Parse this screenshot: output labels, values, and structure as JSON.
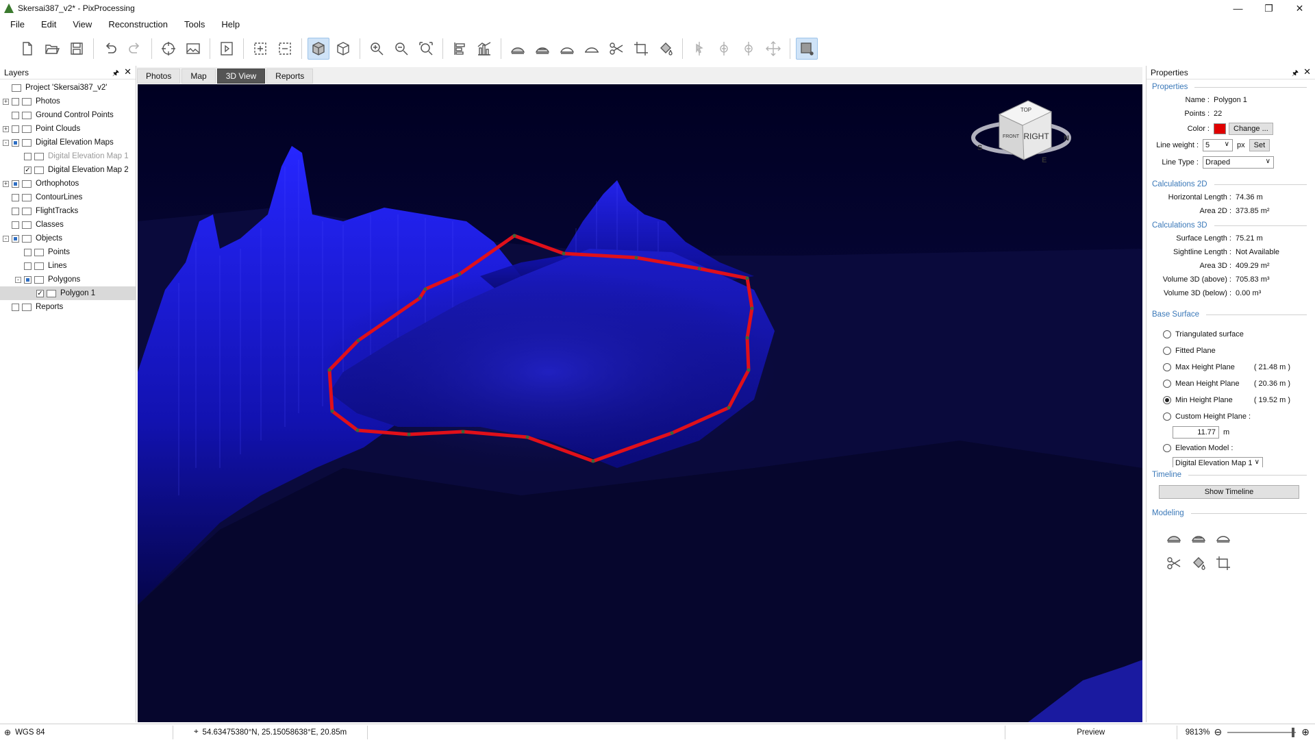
{
  "window": {
    "title": "Skersai387_v2* - PixProcessing",
    "controls": [
      "—",
      "❐",
      "✕"
    ]
  },
  "menu": [
    "File",
    "Edit",
    "View",
    "Reconstruction",
    "Tools",
    "Help"
  ],
  "toolbar_icons": [
    "new-file-icon",
    "open-folder-icon",
    "save-icon",
    "undo-icon",
    "redo-icon",
    "target-icon",
    "image-icon",
    "play-icon",
    "select-area-icon",
    "deselect-area-icon",
    "view-3d-solid-icon",
    "view-3d-wire-icon",
    "zoom-in-icon",
    "zoom-out-icon",
    "zoom-fit-icon",
    "align-icon",
    "chart-icon",
    "terrain-1-icon",
    "terrain-2-icon",
    "terrain-3-icon",
    "terrain-4-icon",
    "scissors-icon",
    "crop-icon",
    "fill-icon",
    "pointer-icon",
    "add-point-icon",
    "remove-point-icon",
    "move-point-icon",
    "draw-polygon-icon"
  ],
  "layers": {
    "title": "Layers",
    "items": [
      {
        "label": "Project 'Skersai387_v2'",
        "depth": 0,
        "expander": "none",
        "checkbox": "none"
      },
      {
        "label": "Photos",
        "depth": 0,
        "expander": "+",
        "checkbox": "empty"
      },
      {
        "label": "Ground Control Points",
        "depth": 0,
        "expander": "none",
        "checkbox": "empty"
      },
      {
        "label": "Point Clouds",
        "depth": 0,
        "expander": "+",
        "checkbox": "empty"
      },
      {
        "label": "Digital Elevation Maps",
        "depth": 0,
        "expander": "-",
        "checkbox": "partial"
      },
      {
        "label": "Digital Elevation Map 1",
        "depth": 1,
        "expander": "none",
        "checkbox": "empty",
        "dim": true
      },
      {
        "label": "Digital Elevation Map 2",
        "depth": 1,
        "expander": "none",
        "checkbox": "checked"
      },
      {
        "label": "Orthophotos",
        "depth": 0,
        "expander": "+",
        "checkbox": "partial"
      },
      {
        "label": "ContourLines",
        "depth": 0,
        "expander": "none",
        "checkbox": "empty"
      },
      {
        "label": "FlightTracks",
        "depth": 0,
        "expander": "none",
        "checkbox": "empty"
      },
      {
        "label": "Classes",
        "depth": 0,
        "expander": "none",
        "checkbox": "empty"
      },
      {
        "label": "Objects",
        "depth": 0,
        "expander": "-",
        "checkbox": "partial"
      },
      {
        "label": "Points",
        "depth": 1,
        "expander": "none",
        "checkbox": "empty"
      },
      {
        "label": "Lines",
        "depth": 1,
        "expander": "none",
        "checkbox": "empty"
      },
      {
        "label": "Polygons",
        "depth": 1,
        "expander": "-",
        "checkbox": "partial"
      },
      {
        "label": "Polygon 1",
        "depth": 2,
        "expander": "none",
        "checkbox": "checked",
        "selected": true
      },
      {
        "label": "Reports",
        "depth": 0,
        "expander": "none",
        "checkbox": "empty"
      }
    ]
  },
  "tabs": [
    {
      "label": "Photos",
      "active": false
    },
    {
      "label": "Map",
      "active": false
    },
    {
      "label": "3D View",
      "active": true
    },
    {
      "label": "Reports",
      "active": false
    }
  ],
  "viewport": {
    "cube_face": "RIGHT",
    "cube_top": "TOP",
    "cube_front": "FRONT",
    "compass": [
      "S",
      "E",
      "N"
    ],
    "polygon_color": "#e0101a"
  },
  "properties": {
    "title": "Properties",
    "section_properties": "Properties",
    "name_label": "Name :",
    "name_value": "Polygon 1",
    "points_label": "Points :",
    "points_value": "22",
    "color_label": "Color :",
    "color_value": "#e00000",
    "change_button": "Change ...",
    "lineweight_label": "Line weight :",
    "lineweight_value": "5",
    "lineweight_unit": "px",
    "set_button": "Set",
    "linetype_label": "Line Type :",
    "linetype_value": "Draped",
    "section_calc2d": "Calculations 2D",
    "horiz_len_label": "Horizontal Length :",
    "horiz_len_value": "74.36 m",
    "area2d_label": "Area 2D :",
    "area2d_value": "373.85 m²",
    "section_calc3d": "Calculations 3D",
    "surf_len_label": "Surface Length :",
    "surf_len_value": "75.21 m",
    "sight_len_label": "Sightline Length :",
    "sight_len_value": "Not Available",
    "area3d_label": "Area 3D :",
    "area3d_value": "409.29 m²",
    "vol_above_label": "Volume 3D (above) :",
    "vol_above_value": "705.83 m³",
    "vol_below_label": "Volume 3D (below) :",
    "vol_below_value": "0.00 m³",
    "section_base": "Base Surface",
    "base_options": [
      {
        "label": "Triangulated surface",
        "extra": "",
        "selected": false
      },
      {
        "label": "Fitted Plane",
        "extra": "",
        "selected": false
      },
      {
        "label": "Max Height Plane",
        "extra": "( 21.48 m )",
        "selected": false
      },
      {
        "label": "Mean Height Plane",
        "extra": "( 20.36 m )",
        "selected": false
      },
      {
        "label": "Min Height Plane",
        "extra": "( 19.52 m )",
        "selected": true
      },
      {
        "label": "Custom Height Plane :",
        "extra": "",
        "selected": false
      }
    ],
    "custom_height_value": "11.77",
    "custom_height_unit": "m",
    "elevation_model_label": "Elevation Model :",
    "elevation_model_value": "Digital Elevation Map 1",
    "section_timeline": "Timeline",
    "show_timeline_button": "Show Timeline",
    "section_modeling": "Modeling",
    "modeling_icons": [
      "terrain-1-icon",
      "terrain-2-icon",
      "terrain-3-icon",
      "scissors-icon",
      "fill-icon",
      "crop-icon"
    ]
  },
  "status": {
    "crs": "WGS 84",
    "coords": "54.63475380°N, 25.15058638°E, 20.85m",
    "mode": "Preview",
    "zoom": "9813%",
    "zoom_fraction": 0.98
  }
}
